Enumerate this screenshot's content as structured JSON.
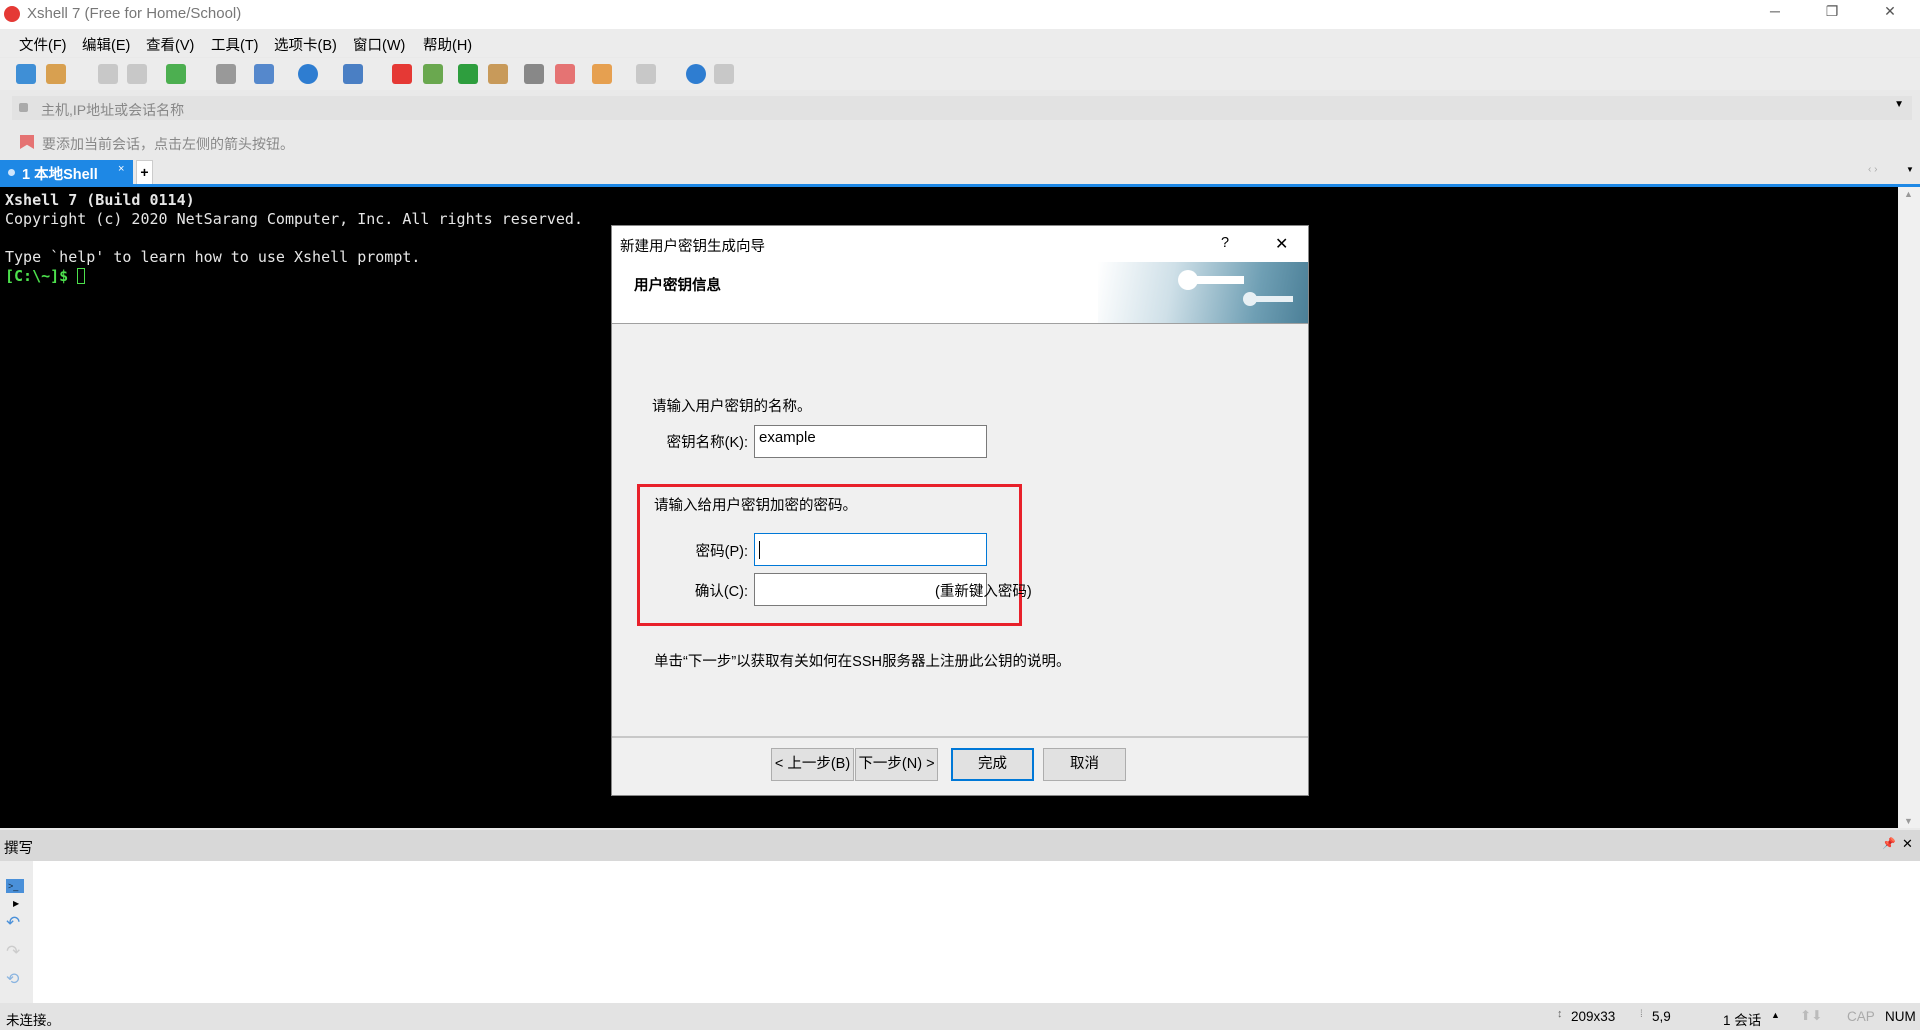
{
  "window": {
    "title": "Xshell 7 (Free for Home/School)"
  },
  "menu": [
    "文件(F)",
    "编辑(E)",
    "查看(V)",
    "工具(T)",
    "选项卡(B)",
    "窗口(W)",
    "帮助(H)"
  ],
  "toolbar": [
    {
      "icon": "new-session-icon",
      "color": "#3f8fd6"
    },
    {
      "icon": "open-folder-icon",
      "color": "#d8a050"
    },
    {
      "icon": "connect-icon",
      "color": "#c8c8c8"
    },
    {
      "icon": "disconnect-icon",
      "color": "#c8c8c8"
    },
    {
      "icon": "properties-icon",
      "color": "#4caf50"
    },
    {
      "icon": "find-icon",
      "color": "#999999"
    },
    {
      "icon": "transfer-icon",
      "color": "#5588cc"
    },
    {
      "icon": "globe-icon",
      "color": "#2e7dd1"
    },
    {
      "icon": "font-icon",
      "color": "#4a7fc4"
    },
    {
      "icon": "xshell-icon",
      "color": "#e53935"
    },
    {
      "icon": "xftp-icon",
      "color": "#6aa84f"
    },
    {
      "icon": "fullscreen-icon",
      "color": "#2e9e3e"
    },
    {
      "icon": "lock-icon",
      "color": "#c89a5a"
    },
    {
      "icon": "keyboard-icon",
      "color": "#888888"
    },
    {
      "icon": "highlight-icon",
      "color": "#e57373"
    },
    {
      "icon": "new-tab-group-icon",
      "color": "#e6a050"
    },
    {
      "icon": "layout-icon",
      "color": "#c8c8c8"
    },
    {
      "icon": "help-icon",
      "color": "#2e7dd1"
    },
    {
      "icon": "chat-icon",
      "color": "#c8c8c8"
    }
  ],
  "address": {
    "placeholder": "主机,IP地址或会话名称"
  },
  "hint": "要添加当前会话，点击左侧的箭头按钮。",
  "tabs": [
    {
      "label": "1 本地Shell",
      "close": "×"
    }
  ],
  "tab_add": "+",
  "terminal": {
    "lines": [
      "Xshell 7 (Build 0114)",
      "Copyright (c) 2020 NetSarang Computer, Inc. All rights reserved.",
      "",
      "Type `help' to learn how to use Xshell prompt."
    ],
    "prompt": "[C:\\~]$ "
  },
  "dialog": {
    "title": "新建用户密钥生成向导",
    "help": "?",
    "close": "✕",
    "header": "用户密钥信息",
    "name_prompt": "请输入用户密钥的名称。",
    "name_label": "密钥名称(K):",
    "name_value": "example",
    "pass_prompt": "请输入给用户密钥加密的密码。",
    "pass_label": "密码(P):",
    "pass_value": "",
    "confirm_label": "确认(C):",
    "confirm_value": "",
    "confirm_hint": "(重新键入密码)",
    "note": "单击“下一步”以获取有关如何在SSH服务器上注册此公钥的说明。",
    "buttons": {
      "back": "< 上一步(B)",
      "next": "下一步(N) >",
      "finish": "完成",
      "cancel": "取消"
    }
  },
  "compose": {
    "title": "撰写"
  },
  "status": {
    "left": "未连接。",
    "size": "209x33",
    "pos": "5,9",
    "sessions": "1 会话",
    "cap": "CAP",
    "num": "NUM"
  },
  "colors": {
    "accent": "#1e88e5",
    "highlight_box": "#e8202a"
  }
}
